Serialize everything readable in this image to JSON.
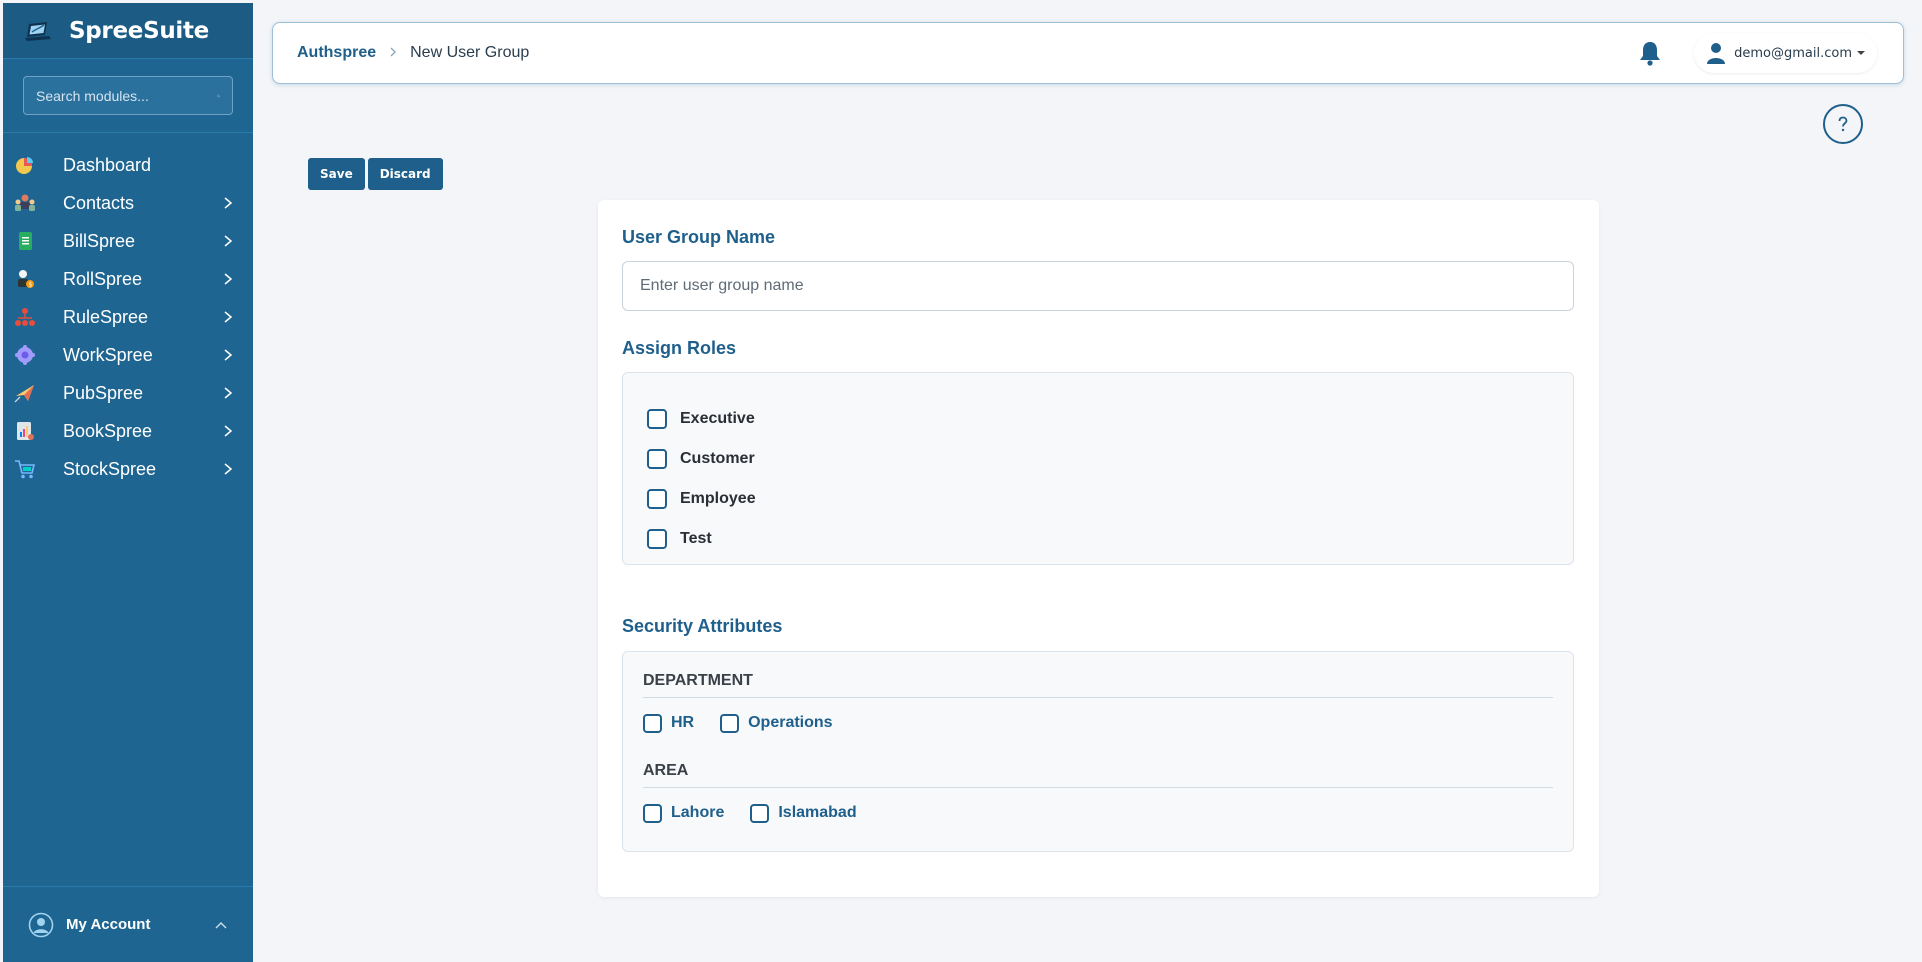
{
  "sidebar": {
    "brand": "SpreeSuite",
    "search_placeholder": "Search modules...",
    "items": [
      {
        "label": "Dashboard",
        "icon": "dashboard-pie-icon",
        "has_children": false
      },
      {
        "label": "Contacts",
        "icon": "contacts-people-icon",
        "has_children": true
      },
      {
        "label": "BillSpree",
        "icon": "bill-sheet-icon",
        "has_children": true
      },
      {
        "label": "RollSpree",
        "icon": "roll-person-icon",
        "has_children": true
      },
      {
        "label": "RuleSpree",
        "icon": "rule-hierarchy-icon",
        "has_children": true
      },
      {
        "label": "WorkSpree",
        "icon": "work-gear-icon",
        "has_children": true
      },
      {
        "label": "PubSpree",
        "icon": "pub-plane-icon",
        "has_children": true
      },
      {
        "label": "BookSpree",
        "icon": "book-report-icon",
        "has_children": true
      },
      {
        "label": "StockSpree",
        "icon": "stock-cart-icon",
        "has_children": true
      }
    ],
    "account_label": "My Account"
  },
  "header": {
    "breadcrumb_root": "Authspree",
    "breadcrumb_current": "New User Group",
    "user_email": "demo@gmail.com"
  },
  "toolbar": {
    "save_label": "Save",
    "discard_label": "Discard"
  },
  "form": {
    "name_title": "User Group Name",
    "name_placeholder": "Enter user group name",
    "name_value": "",
    "roles_title": "Assign Roles",
    "roles": [
      "Executive",
      "Customer",
      "Employee",
      "Test"
    ],
    "security_title": "Security Attributes",
    "attributes": [
      {
        "name": "DEPARTMENT",
        "options": [
          "HR",
          "Operations"
        ]
      },
      {
        "name": "AREA",
        "options": [
          "Lahore",
          "Islamabad"
        ]
      }
    ]
  },
  "colors": {
    "sidebar_bg": "#1f6591",
    "accent": "#1f5f8b",
    "page_bg": "#f3f5f8"
  }
}
